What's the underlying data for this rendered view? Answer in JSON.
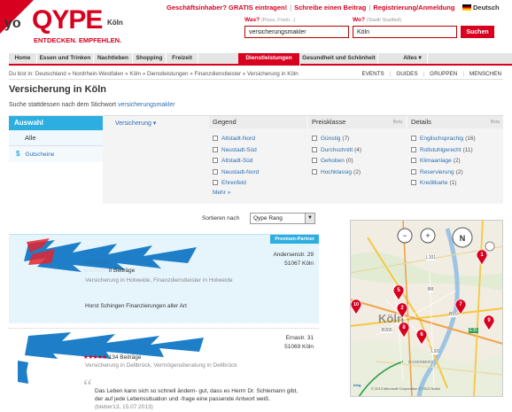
{
  "brand": {
    "logo_prefix": "yo",
    "logo": "QYPE",
    "city": "Köln",
    "tagline": "ENTDECKEN. EMPFEHLEN."
  },
  "top_links": [
    "Geschäftsinhaber? GRATIS eintragen!",
    "Schreibe einen Beitrag",
    "Registrierung/Anmeldung"
  ],
  "language": "Deutsch",
  "search": {
    "what_label": "Was?",
    "what_hint": "(Pizza, Frisör...)",
    "what_value": "versicherungsmakler",
    "where_label": "Wo?",
    "where_hint": "(Stadt/ Stadtteil)",
    "where_value": "Köln",
    "button": "Suchen"
  },
  "nav": [
    "Home",
    "Essen und Trinken",
    "Nachtleben",
    "Shopping",
    "Freizeit",
    "Dienstleistungen",
    "Gesundheit und Schönheit",
    "Alles ▾"
  ],
  "nav_active": "Dienstleistungen",
  "breadcrumb": "Du bist in: Deutschland » Nordrhein-Westfalen » Köln » Dienstleistungen » Finanzdienstleister » Versicherung in Köln",
  "sub_links": [
    "EVENTS",
    "GUIDES",
    "GRUPPEN",
    "MENSCHEN"
  ],
  "page_title": "Versicherung in Köln",
  "search_hint": {
    "prefix": "Suche stattdessen nach dem Stichwort",
    "keyword": "versicherungsmakler"
  },
  "auswahl": {
    "header": "Auswahl",
    "all": "Alle",
    "gutscheine": "Gutscheine"
  },
  "category_dropdown": "Versicherung ▾",
  "filters": {
    "gegend": {
      "title": "Gegend",
      "items": [
        "Altstadt-Nord",
        "Neustadt-Süd",
        "Altstadt-Süd",
        "Neustadt-Nord",
        "Ehrenfeld"
      ],
      "more": "Mehr »"
    },
    "preisklasse": {
      "title": "Preisklasse",
      "beta": "Beta",
      "items": [
        {
          "label": "Günstig",
          "count": "(7)"
        },
        {
          "label": "Durchschnitt",
          "count": "(4)"
        },
        {
          "label": "Gehoben",
          "count": "(0)"
        },
        {
          "label": "Hochklassig",
          "count": "(2)"
        }
      ]
    },
    "details": {
      "title": "Details",
      "beta": "Beta",
      "items": [
        {
          "label": "Englischsprachig",
          "count": "(16)"
        },
        {
          "label": "Rollstuhlgerecht",
          "count": "(11)"
        },
        {
          "label": "Klimaanlage",
          "count": "(2)"
        },
        {
          "label": "Reservierung",
          "count": "(2)"
        },
        {
          "label": "Kreditkarte",
          "count": "(1)"
        }
      ]
    }
  },
  "sort": {
    "label": "Sortieren nach",
    "value": "Qype Rang"
  },
  "results": [
    {
      "badge": "Premium-Partner",
      "name_fragment": "Holweide",
      "reviews": "0 Beiträge",
      "categories": "Versicherung in Holweide, Finanzdienstleister in Holweide",
      "street": "Andersenstr. 29",
      "city": "51067 Köln",
      "snippet": "Horst Schingen Finanzierungen aller Art"
    },
    {
      "reviews": "134 Beiträge",
      "categories": "Versicherung in Dellbrück, Vermögensberatung in Dellbrück",
      "street": "Ernastr. 31",
      "city": "51069 Köln",
      "snippet": "Das Leben kann sich so schnell ändern- gut, dass es Herrn Dr. Schlemann gibt, der auf jede Lebenssituation und -frage eine passende Antwort weiß.",
      "meta": "(bieber13, 15.07.2013)"
    }
  ],
  "map": {
    "city_label": "Köln",
    "copyright": "© 2013 Microsoft Corporation  © 2013 Nokia",
    "markers": [
      "1",
      "2",
      "5",
      "6",
      "7",
      "8",
      "9",
      "10"
    ],
    "road_labels": [
      "L101",
      "B8",
      "B55",
      "B265",
      "L92",
      "E35",
      "RADERBERG"
    ]
  }
}
